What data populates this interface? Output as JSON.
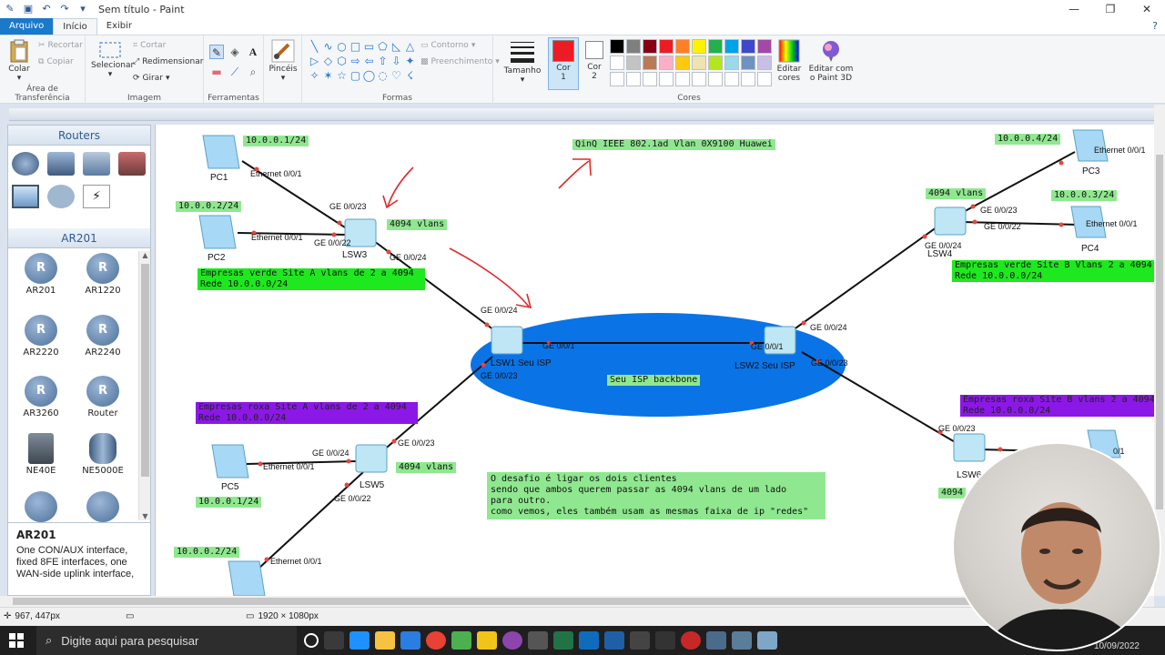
{
  "window": {
    "title": "Sem título - Paint",
    "controls": [
      "minimize",
      "maximize",
      "close"
    ]
  },
  "tabs": [
    {
      "label": "Arquivo"
    },
    {
      "label": "Início"
    },
    {
      "label": "Exibir"
    }
  ],
  "ribbon": {
    "clipboard": {
      "paste": "Colar",
      "cut": "Recortar",
      "copy": "Copiar",
      "label": "Área de Transferência"
    },
    "image": {
      "select": "Selecionar",
      "crop": "Cortar",
      "resize": "Redimensionar",
      "rotate": "Girar",
      "label": "Imagem"
    },
    "tools": {
      "label": "Ferramentas"
    },
    "brushes": {
      "label": "Pincéis"
    },
    "shapes": {
      "outline": "Contorno",
      "fill": "Preenchimento",
      "label": "Formas"
    },
    "size": {
      "label": "Tamanho"
    },
    "color1": {
      "label": "Cor",
      "num": "1",
      "color": "#ed1c24"
    },
    "color2": {
      "label": "Cor",
      "num": "2",
      "color": "#ffffff"
    },
    "colors": {
      "label": "Cores",
      "row1": [
        "#000000",
        "#7f7f7f",
        "#880015",
        "#ed1c24",
        "#ff7f27",
        "#fff200",
        "#22b14c",
        "#00a2e8",
        "#3f48cc",
        "#a349a4"
      ],
      "row2": [
        "#ffffff",
        "#c3c3c3",
        "#b97a57",
        "#ffaec9",
        "#ffc90e",
        "#efe4b0",
        "#b5e61d",
        "#99d9ea",
        "#7092be",
        "#c8bfe7"
      ]
    },
    "edit_colors": {
      "line1": "Editar",
      "line2": "cores"
    },
    "paint3d": {
      "line1": "Editar com",
      "line2": "o Paint 3D"
    }
  },
  "device_panel": {
    "routers_header": "Routers",
    "ar_header": "AR201",
    "items": [
      "AR201",
      "AR1220",
      "AR2220",
      "AR2240",
      "AR3260",
      "Router",
      "NE40E",
      "NE5000E"
    ],
    "desc_title": "AR201",
    "desc_text": "One CON/AUX interface, fixed 8FE interfaces, one WAN-side uplink interface,"
  },
  "diagram": {
    "top_note": "QinQ IEEE 802.1ad Vlan 0X9100 Huawei",
    "backbone_label": "Seu ISP backbone",
    "pcs": {
      "pc1": {
        "name": "PC1",
        "ip": "10.0.0.1/24",
        "port": "Ethernet 0/0/1"
      },
      "pc2": {
        "name": "PC2",
        "ip": "10.0.0.2/24",
        "port": "Ethernet 0/0/1"
      },
      "pc3": {
        "name": "PC3",
        "ip": "10.0.0.4/24",
        "port": "Ethernet 0/0/1"
      },
      "pc4": {
        "name": "PC4",
        "ip": "10.0.0.3/24",
        "port": "Ethernet 0/0/1"
      },
      "pc5": {
        "name": "PC5",
        "ip": "10.0.0.1/24",
        "port": "Ethernet 0/0/1"
      },
      "pc6": {
        "ip": "10.0.0.2/24",
        "port": "Ethernet 0/0/1"
      }
    },
    "switches": {
      "lsw3": {
        "name": "LSW3",
        "vlans": "4094 vlans",
        "p1": "GE 0/0/23",
        "p2": "GE 0/0/22",
        "p3": "GE 0/0/24"
      },
      "lsw4": {
        "name": "LSW4",
        "vlans": "4094 vlans",
        "p1": "GE 0/0/23",
        "p2": "GE 0/0/22",
        "p3": "GE 0/0/24"
      },
      "lsw5": {
        "name": "LSW5",
        "vlans": "4094 vlans",
        "p1": "GE 0/0/24",
        "p2": "GE 0/0/23",
        "p3": "GE 0/0/22"
      },
      "lsw6": {
        "name": "LSW6",
        "vlans": "4094",
        "p1": "GE 0/0/23",
        "p2": "0/1"
      },
      "lsw1": {
        "name": "LSW1 Seu ISP",
        "p1": "GE 0/0/24",
        "p2": "GE 0/0/1",
        "p3": "GE 0/0/23"
      },
      "lsw2": {
        "name": "LSW2 Seu ISP",
        "p1": "GE 0/0/24",
        "p2": "GE 0/0/1",
        "p3": "GE 0/0/23"
      }
    },
    "notes": {
      "green_a_1": "Empresas verde Site A vlans de 2 a 4094",
      "green_a_2": "Rede 10.0.0.0/24",
      "green_b_1": "Empresas verde Site B Vlans 2 a 4094",
      "green_b_2": "Rede 10.0.0.0/24",
      "purple_a_1": "Empresas roxa Site A vlans de 2 a 4094",
      "purple_a_2": "Rede 10.0.0.0/24",
      "purple_b_1": "Empresas roxa Site B vlans 2 a 4094",
      "purple_b_2": "Rede 10.0.0.0/24",
      "challenge_1": "O desafio é ligar os dois clientes",
      "challenge_2": "sendo que ambos querem passar as 4094 vlans de um lado",
      "challenge_3": "para outro.",
      "challenge_4": "como vemos, eles também usam as mesmas faixa de ip \"redes\""
    }
  },
  "status": {
    "cursor": "967, 447px",
    "dimensions": "1920 × 1080px"
  },
  "taskbar": {
    "search_placeholder": "Digite aqui para pesquisar",
    "date": "10/09/2022"
  }
}
